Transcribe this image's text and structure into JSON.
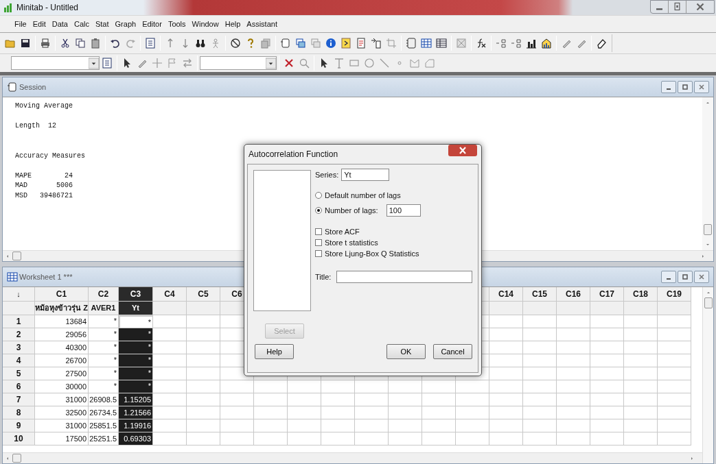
{
  "window": {
    "title": "Minitab - Untitled"
  },
  "menu": [
    "File",
    "Edit",
    "Data",
    "Calc",
    "Stat",
    "Graph",
    "Editor",
    "Tools",
    "Window",
    "Help",
    "Assistant"
  ],
  "session": {
    "title": "Session",
    "blocks": [
      [
        "Moving Average"
      ],
      [
        "Length  12"
      ],
      [
        "Accuracy Measures"
      ],
      [
        "MAPE        24",
        "MAD       5006",
        "MSD   39486721"
      ]
    ]
  },
  "worksheet": {
    "title": "Worksheet 1 ***",
    "corner": "↓",
    "columns_left": [
      {
        "label": "C1",
        "name": "หม้อหุงข้าวรุ่น Z",
        "selected": false
      },
      {
        "label": "C2",
        "name": "AVER1",
        "selected": false
      },
      {
        "label": "C3",
        "name": "Yt",
        "selected": true
      },
      {
        "label": "C4",
        "selected": false
      },
      {
        "label": "C5",
        "selected": false
      },
      {
        "label": "C6",
        "selected": false
      }
    ],
    "columns_right": [
      "C14",
      "C15",
      "C16",
      "C17",
      "C18",
      "C19"
    ],
    "rows": [
      {
        "label": "1",
        "cells": [
          "13684",
          "*",
          "*"
        ],
        "active": true
      },
      {
        "label": "2",
        "cells": [
          "29056",
          "*",
          "*"
        ],
        "active": false
      },
      {
        "label": "3",
        "cells": [
          "40300",
          "*",
          "*"
        ],
        "active": false
      },
      {
        "label": "4",
        "cells": [
          "26700",
          "*",
          "*"
        ],
        "active": false
      },
      {
        "label": "5",
        "cells": [
          "27500",
          "*",
          "*"
        ],
        "active": false
      },
      {
        "label": "6",
        "cells": [
          "30000",
          "*",
          "*"
        ],
        "active": false
      },
      {
        "label": "7",
        "cells": [
          "31000",
          "26908.5",
          "1.15205"
        ],
        "active": false
      },
      {
        "label": "8",
        "cells": [
          "32500",
          "26734.5",
          "1.21566"
        ],
        "active": false
      },
      {
        "label": "9",
        "cells": [
          "31000",
          "25851.5",
          "1.19916"
        ],
        "active": false
      },
      {
        "label": "10",
        "cells": [
          "17500",
          "25251.5",
          "0.69303"
        ],
        "active": false
      }
    ]
  },
  "dialog": {
    "title": "Autocorrelation Function",
    "series_label": "Series:",
    "series_value": "Yt",
    "radios": [
      {
        "label": "Default number of lags",
        "selected": false
      },
      {
        "label": "Number of lags:",
        "selected": true
      }
    ],
    "lags_value": "100",
    "checkboxes": [
      {
        "label": "Store ACF",
        "checked": false
      },
      {
        "label": "Store t statistics",
        "checked": false
      },
      {
        "label": "Store Ljung-Box Q Statistics",
        "checked": false
      }
    ],
    "title_label": "Title:",
    "buttons": [
      {
        "label": "Select",
        "disabled": true
      },
      {
        "label": "Help",
        "disabled": false
      },
      {
        "label": "OK",
        "disabled": false
      },
      {
        "label": "Cancel",
        "disabled": false
      }
    ]
  }
}
